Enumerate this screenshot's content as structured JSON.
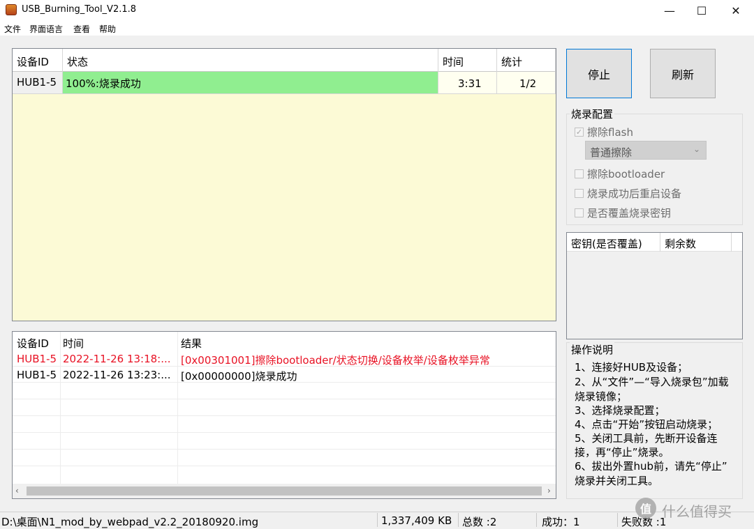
{
  "window": {
    "title": "USB_Burning_Tool_V2.1.8",
    "minimize": "—",
    "maximize": "☐",
    "close": "✕"
  },
  "menu": [
    "文件",
    "界面语言",
    "查看",
    "帮助"
  ],
  "device_grid": {
    "headers": [
      "设备ID",
      "状态",
      "时间",
      "统计"
    ],
    "rows": [
      {
        "id": "HUB1-5",
        "status": "100%:烧录成功",
        "time": "3:31",
        "count": "1/2",
        "progress_fraction": 1.0
      }
    ],
    "background_color": "#fcfad6",
    "progress_color": "#90ee90"
  },
  "buttons": {
    "stop": "停止",
    "refresh": "刷新"
  },
  "burn_config": {
    "title": "烧录配置",
    "erase_flash": {
      "label": "擦除flash",
      "checked": true
    },
    "erase_mode": "普通擦除",
    "erase_bootloader": {
      "label": "擦除bootloader",
      "checked": false
    },
    "reboot_after": {
      "label": "烧录成功后重启设备",
      "checked": false
    },
    "overwrite_key": {
      "label": "是否覆盖烧录密钥",
      "checked": false
    }
  },
  "key_list": {
    "headers": [
      "密钥(是否覆盖)",
      "剩余数"
    ]
  },
  "log": {
    "headers": [
      "设备ID",
      "时间",
      "结果"
    ],
    "rows": [
      {
        "id": "HUB1-5",
        "time": "2022-11-26 13:18:...",
        "result": "[0x00301001]擦除bootloader/状态切换/设备枚举/设备枚举异常",
        "error": true
      },
      {
        "id": "HUB1-5",
        "time": "2022-11-26 13:23:...",
        "result": "[0x00000000]烧录成功",
        "error": false
      }
    ],
    "error_color": "#e81123"
  },
  "instructions": {
    "title": "操作说明",
    "lines": [
      "1、连接好HUB及设备；",
      "2、从“文件”—“导入烧录包”加载",
      "烧录镜像；",
      "3、选择烧录配置；",
      "4、点击“开始”按钮启动烧录；",
      "5、关闭工具前，先断开设备连",
      "接，再“停止”烧录。",
      "6、拔出外置hub前，请先“停止”",
      "烧录并关闭工具。"
    ]
  },
  "status_bar": {
    "path": "D:\\桌面\\N1_mod_by_webpad_v2.2_20180920.img",
    "size": "1,337,409 KB",
    "total": "总数 :2",
    "success": "成功：1",
    "fail": "失败数 :1"
  },
  "watermark": {
    "logo": "值",
    "text": "什么值得买"
  }
}
